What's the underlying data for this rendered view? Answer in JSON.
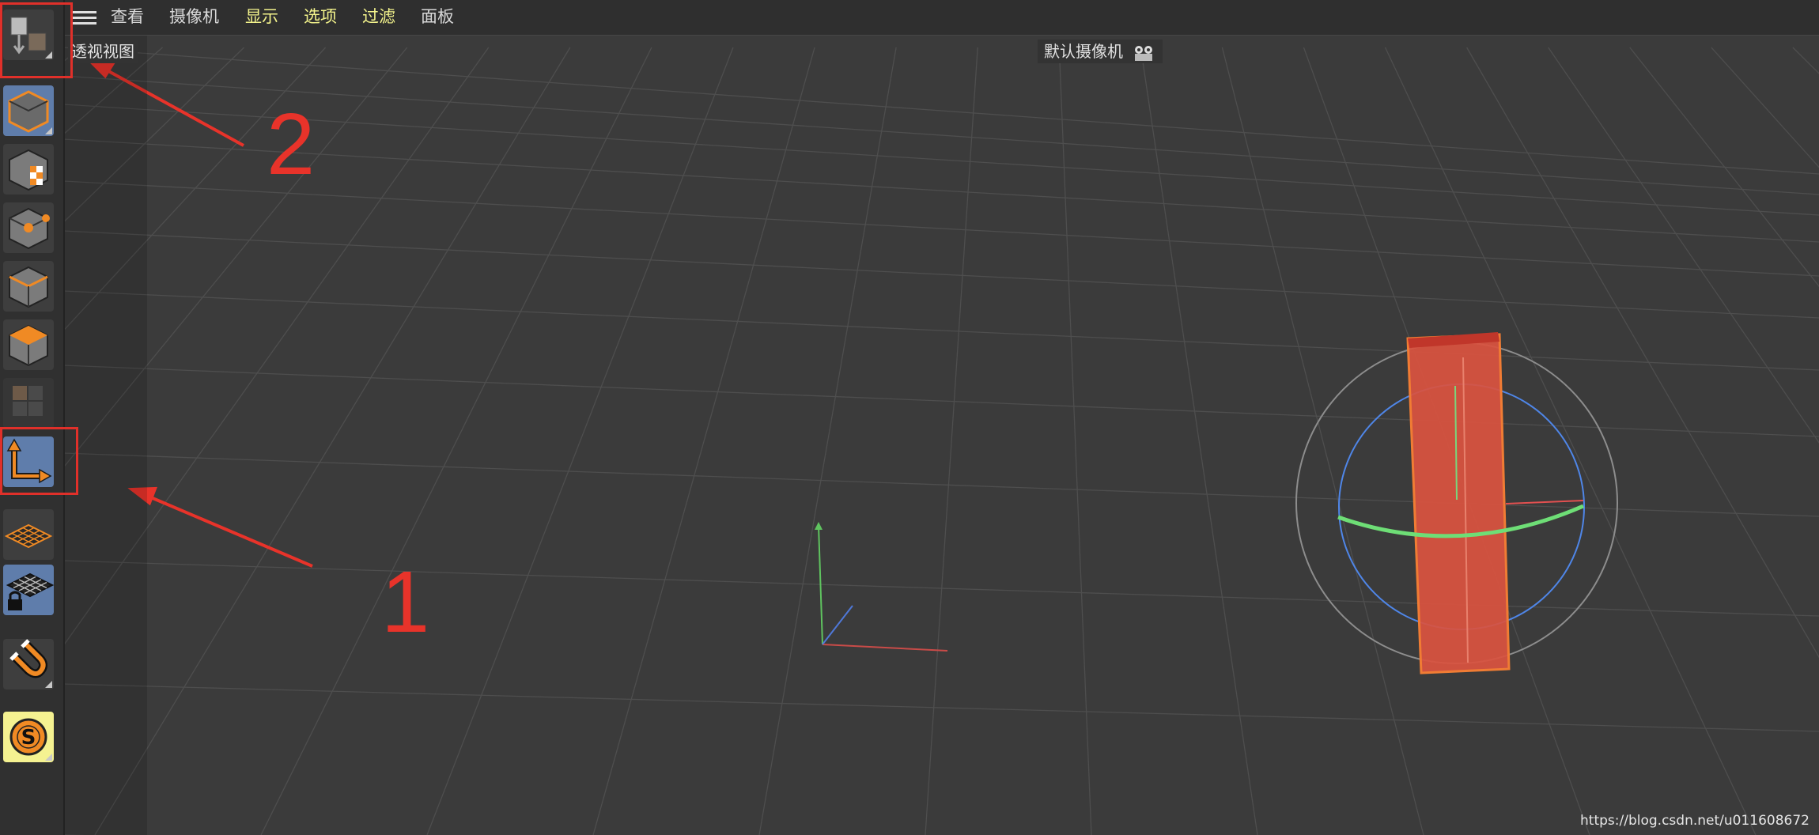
{
  "menu": {
    "items": [
      {
        "label": "查看",
        "highlighted": false
      },
      {
        "label": "摄像机",
        "highlighted": false
      },
      {
        "label": "显示",
        "highlighted": false
      },
      {
        "label": "选项",
        "highlighted": true
      },
      {
        "label": "过滤",
        "highlighted": true
      },
      {
        "label": "面板",
        "highlighted": false
      }
    ]
  },
  "viewport": {
    "view_name": "透视视图",
    "camera_name": "默认摄像机"
  },
  "annotations": {
    "label_1": "1",
    "label_2": "2",
    "color": "#e8332a"
  },
  "watermark": "https://blog.csdn.net/u011608672",
  "toolbar": {
    "tools": [
      {
        "icon": "viewport-solo-icon",
        "active": false
      },
      {
        "icon": "model-mode-icon",
        "active": true
      },
      {
        "icon": "texture-mode-icon",
        "active": false
      },
      {
        "icon": "points-mode-icon",
        "active": false
      },
      {
        "icon": "edges-mode-icon",
        "active": false
      },
      {
        "icon": "polygons-mode-icon",
        "active": false
      },
      {
        "icon": "uv-mode-icon",
        "active": false
      },
      {
        "icon": "enable-axis-icon",
        "active": true
      },
      {
        "icon": "workplane-icon",
        "active": false
      },
      {
        "icon": "locked-workplane-icon",
        "active": true
      },
      {
        "icon": "snap-magnet-icon",
        "active": false
      },
      {
        "icon": "soft-selection-icon",
        "active": false
      }
    ]
  },
  "colors": {
    "background": "#3b3b3b",
    "accent_orange": "#f08a24",
    "active_tool": "#5f7dab",
    "object_red": "#d9533f"
  }
}
